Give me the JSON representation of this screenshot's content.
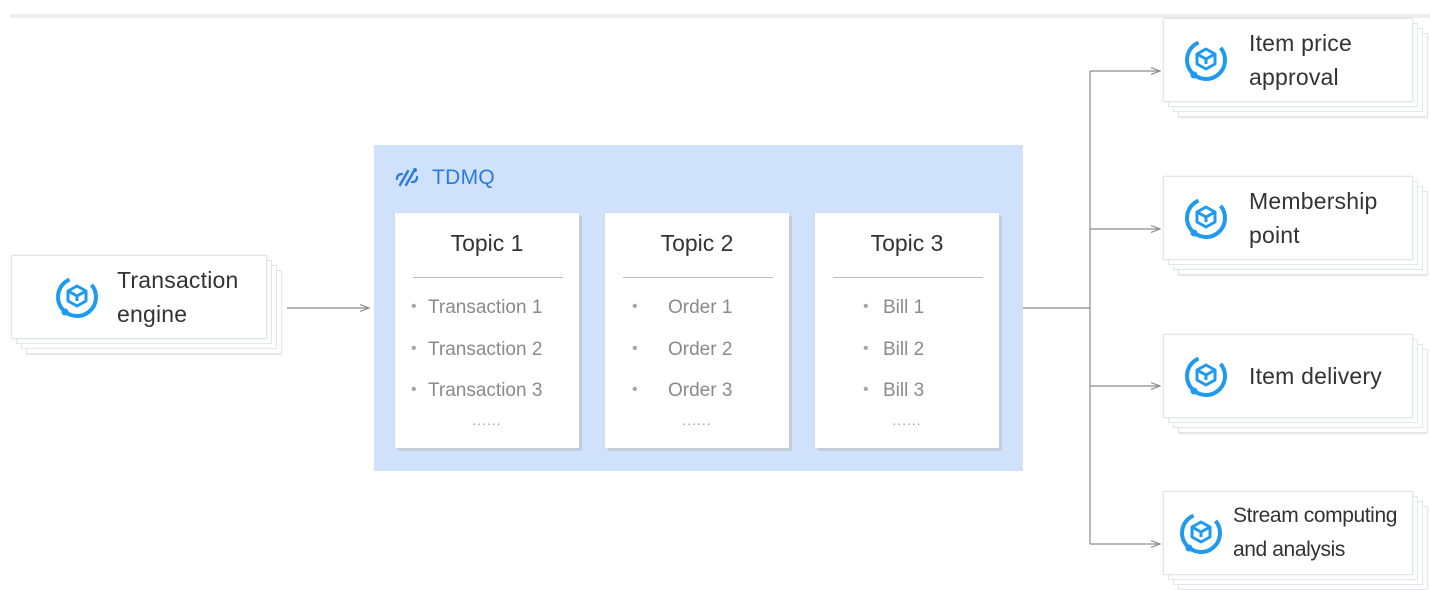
{
  "mq": {
    "name": "TDMQ",
    "topics": [
      {
        "title": "Topic 1",
        "items": [
          "Transaction 1",
          "Transaction 2",
          "Transaction 3"
        ],
        "more": "......"
      },
      {
        "title": "Topic 2",
        "items": [
          "Order 1",
          "Order 2",
          "Order 3"
        ],
        "more": "......"
      },
      {
        "title": "Topic 3",
        "items": [
          "Bill 1",
          "Bill 2",
          "Bill 3"
        ],
        "more": "......"
      }
    ]
  },
  "producer": {
    "line1": "Transaction",
    "line2": "engine"
  },
  "consumers": [
    {
      "line1": "Item price",
      "line2": "approval"
    },
    {
      "line1": "Membership",
      "line2": "point"
    },
    {
      "line1": "Item delivery",
      "line2": ""
    },
    {
      "line1": "Stream computing",
      "line2": "and analysis"
    }
  ],
  "colors": {
    "accent": "#1e9af0",
    "panel": "#cfe1fb",
    "brand": "#2a7ae2",
    "arrow": "#8c8c8c"
  }
}
